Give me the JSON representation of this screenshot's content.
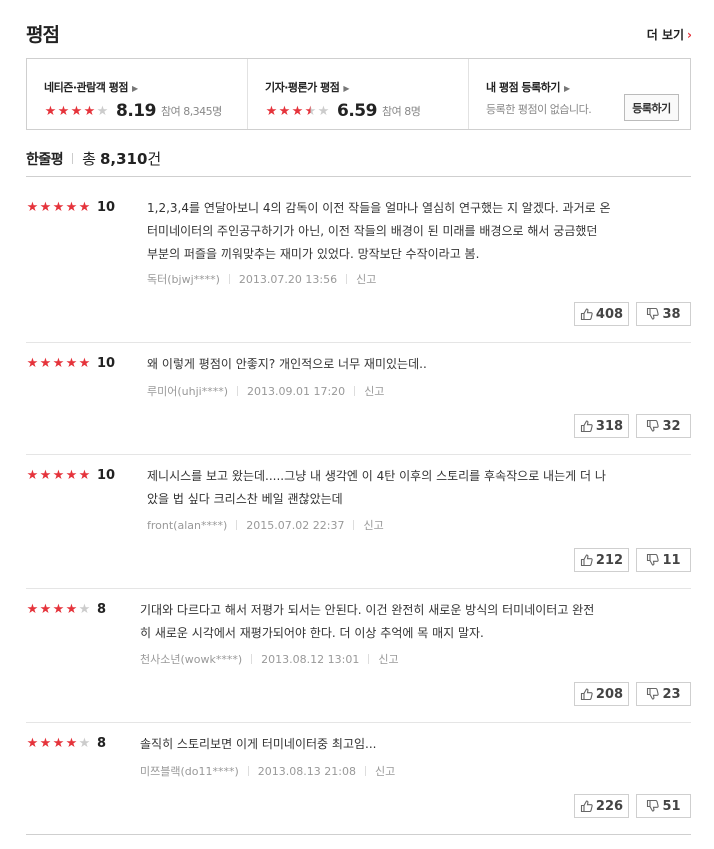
{
  "header": {
    "title": "평점",
    "more_label": "더 보기"
  },
  "summary": {
    "audience": {
      "label": "네티즌·관람객 평점",
      "score": "8.19",
      "participants": "참여 8,345명",
      "stars_fraction": 0.82
    },
    "critic": {
      "label": "기자·평론가 평점",
      "score": "6.59",
      "participants": "참여 8명",
      "stars_fraction": 0.66
    },
    "mine": {
      "label": "내 평점 등록하기",
      "note": "등록한 평점이 없습니다.",
      "button": "등록하기"
    }
  },
  "oneline": {
    "title": "한줄평",
    "total_label": "총",
    "total": "8,310",
    "unit": "건"
  },
  "reviews": [
    {
      "score": "10",
      "stars_fraction": 1.0,
      "lines": [
        "1,2,3,4를 연달아보니 4의 감독이 이전 작들을 얼마나 열심히 연구했는 지 알겠다. 과거로 온",
        "터미네이터의 주인공구하기가 아닌, 이전 작들의 배경이 된 미래를 배경으로 해서 궁금했던",
        "부분의 퍼즐을 끼워맞추는 재미가 있었다. 망작보단 수작이라고 봄."
      ],
      "user": "독터(bjwj****)",
      "date": "2013.07.20 13:56",
      "report": "신고",
      "likes": "408",
      "dislikes": "38"
    },
    {
      "score": "10",
      "stars_fraction": 1.0,
      "lines": [
        "왜 이렇게 평점이 안좋지? 개인적으로 너무 재미있는데.."
      ],
      "user": "루미어(uhji****)",
      "date": "2013.09.01 17:20",
      "report": "신고",
      "likes": "318",
      "dislikes": "32"
    },
    {
      "score": "10",
      "stars_fraction": 1.0,
      "lines": [
        "제니시스를 보고 왔는데.....그냥 내 생각엔 이 4탄 이후의 스토리를 후속작으로 내는게 더 나",
        "았을 법 싶다 크리스찬 베일 괜찮았는데"
      ],
      "user": "front(alan****)",
      "date": "2015.07.02 22:37",
      "report": "신고",
      "likes": "212",
      "dislikes": "11"
    },
    {
      "score": "8",
      "stars_fraction": 0.8,
      "lines": [
        "기대와 다르다고 해서 저평가 되서는 안된다. 이건 완전히 새로운 방식의 터미네이터고 완전",
        "히 새로운 시각에서 재평가되어야 한다. 더 이상 추억에 목 매지 말자."
      ],
      "user": "천사소년(wowk****)",
      "date": "2013.08.12 13:01",
      "report": "신고",
      "likes": "208",
      "dislikes": "23"
    },
    {
      "score": "8",
      "stars_fraction": 0.8,
      "lines": [
        "솔직히 스토리보면 이게 터미네이터중 최고임..."
      ],
      "user": "미쯔블랙(do11****)",
      "date": "2013.08.13 21:08",
      "report": "신고",
      "likes": "226",
      "dislikes": "51"
    }
  ],
  "colors": {
    "accent": "#e5333b",
    "star_off": "#cccccc",
    "border": "#cfcfcf"
  },
  "icons": {
    "like": "thumbs-up-icon",
    "dislike": "thumbs-down-icon",
    "more": "chevron-right-icon"
  }
}
